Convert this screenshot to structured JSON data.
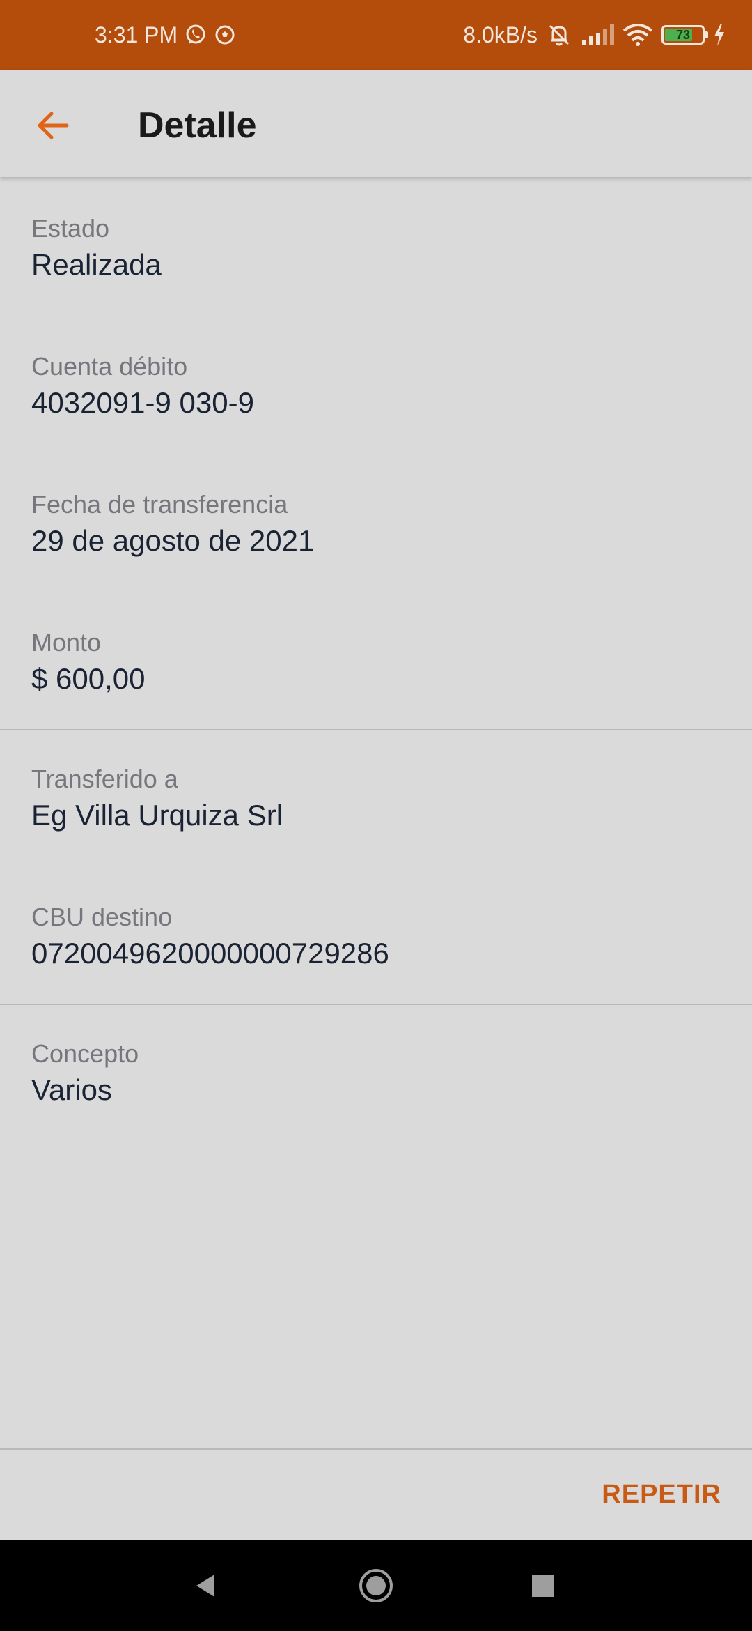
{
  "status_bar": {
    "time": "3:31 PM",
    "net_speed": "8.0kB/s",
    "battery_level": "73",
    "icons": [
      "whatsapp-icon",
      "soccer-ball-icon",
      "mute-icon",
      "signal-icon",
      "wifi-icon",
      "battery-icon",
      "charging-icon"
    ],
    "background_color": "#b44c0c"
  },
  "app_bar": {
    "title": "Detalle",
    "back_icon": "arrow-left-icon",
    "accent_color": "#e06418"
  },
  "details": {
    "estado": {
      "label": "Estado",
      "value": "Realizada"
    },
    "cuenta_debito": {
      "label": "Cuenta débito",
      "value": "4032091-9 030-9"
    },
    "fecha": {
      "label": "Fecha de transferencia",
      "value": "29 de agosto de 2021"
    },
    "monto": {
      "label": "Monto",
      "value": "$ 600,00"
    },
    "transferido": {
      "label": "Transferido a",
      "value": "Eg Villa Urquiza Srl"
    },
    "cbu": {
      "label": "CBU destino",
      "value": "0720049620000000729286"
    },
    "concepto": {
      "label": "Concepto",
      "value": "Varios"
    }
  },
  "actions": {
    "repeat_label": "REPETIR"
  },
  "nav_bar": {
    "icons": [
      "back-triangle-icon",
      "home-circle-icon",
      "recents-square-icon"
    ]
  }
}
